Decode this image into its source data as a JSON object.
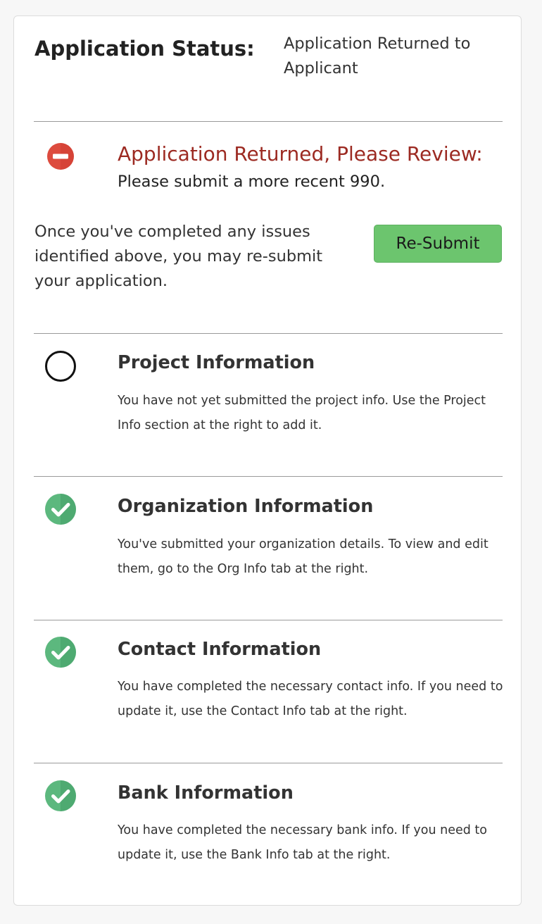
{
  "status": {
    "label": "Application Status:",
    "value": "Application Returned to Applicant"
  },
  "alert": {
    "icon": "minus-circle-icon",
    "color": "#9c2a22",
    "title": "Application Returned, Please Review:",
    "message": "Please submit a more recent 990."
  },
  "resubmit": {
    "text": "Once you've completed any issues identified above, you may re-submit your application.",
    "button_label": "Re-Submit",
    "button_color": "#6cc56e"
  },
  "sections": [
    {
      "title": "Project Information",
      "description": "You have not yet submitted the project info. Use the Project Info section at the right to add it.",
      "icon": "empty-circle-icon",
      "state": "incomplete"
    },
    {
      "title": "Organization Information",
      "description": "You've submitted your organization details. To view and edit them, go to the Org Info tab at the right.",
      "icon": "check-circle-icon",
      "state": "complete"
    },
    {
      "title": "Contact Information",
      "description": "You have completed the necessary contact info. If you need to update it, use the Contact Info tab at the right.",
      "icon": "check-circle-icon",
      "state": "complete"
    },
    {
      "title": "Bank Information",
      "description": "You have completed the necessary bank info. If you need to update it, use the Bank Info tab at the right.",
      "icon": "check-circle-icon",
      "state": "complete"
    }
  ]
}
